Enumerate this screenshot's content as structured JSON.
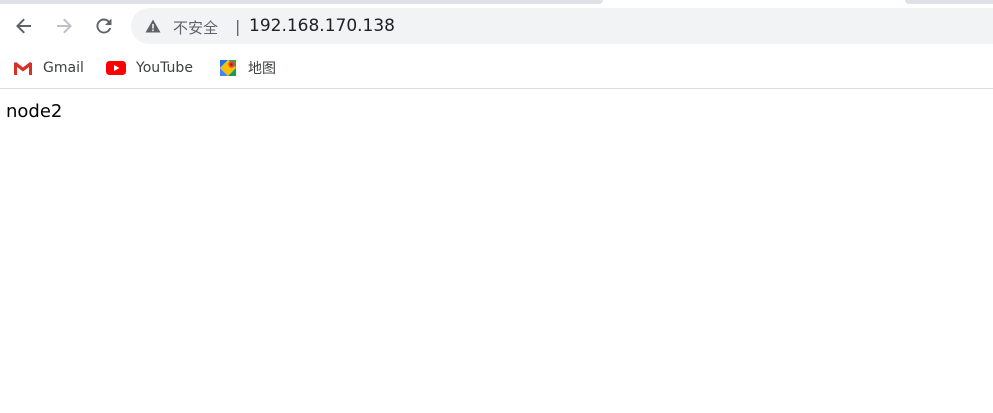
{
  "toolbar": {
    "back_icon": "arrow-left-icon",
    "forward_icon": "arrow-right-icon",
    "reload_icon": "reload-icon"
  },
  "omnibox": {
    "security_icon": "warning-triangle-icon",
    "security_label": "不安全",
    "separator": "|",
    "url": "192.168.170.138"
  },
  "bookmarks": [
    {
      "label": "Gmail",
      "icon": "gmail-icon"
    },
    {
      "label": "YouTube",
      "icon": "youtube-icon"
    },
    {
      "label": "地图",
      "icon": "maps-icon"
    }
  ],
  "page": {
    "body_text": "node2"
  },
  "colors": {
    "omnibox_bg": "#f1f3f4",
    "gmail_red": "#d93025",
    "youtube_red": "#ff0000"
  }
}
